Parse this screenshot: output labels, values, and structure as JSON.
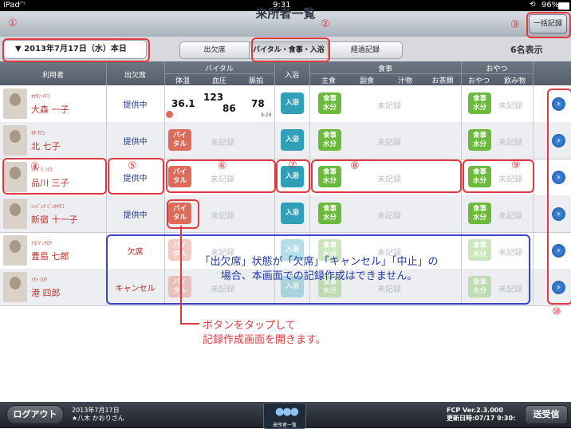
{
  "status_bar": {
    "carrier": "iPad",
    "time": "9:31",
    "battery": "96%"
  },
  "nav": {
    "title": "来所者一覧",
    "bulk_button": "一括記録"
  },
  "toolbar": {
    "date": "▼ 2013年7月17日（水）本日",
    "tabs": [
      "出欠席",
      "バイタル・食事・入浴",
      "経過記録"
    ],
    "count": "6名表示"
  },
  "header": {
    "user": "利用者",
    "attendance": "出欠席",
    "vital": "バイタル",
    "vital_sub": [
      "体温",
      "血圧",
      "脈拍"
    ],
    "bath": "入浴",
    "meal": "食事",
    "meal_sub": [
      "主食",
      "副食",
      "汁物",
      "お茶類"
    ],
    "snack": "おやつ",
    "snack_sub": [
      "おやつ",
      "飲み物"
    ]
  },
  "labels": {
    "vital_pill": "バイ\nタル",
    "bath_pill": "入浴",
    "meal_pill": "食事\n水分",
    "unrecorded": "未記録",
    "vital_time": "9:28"
  },
  "rows": [
    {
      "kana": "ｵｵﾓﾘ  ｲﾁｺ",
      "name": "大森 一子",
      "attendance": "提供中",
      "vitals": {
        "temp": "36.1",
        "bp_high": "123",
        "bp_low": "86",
        "pulse": "78"
      }
    },
    {
      "kana": "ｷﾀ  ﾅﾅｺ",
      "name": "北 七子",
      "attendance": "提供中"
    },
    {
      "kana": "ｼﾅｶﾞﾜ  ﾐﾂｺ",
      "name": "品川 三子",
      "attendance": "提供中"
    },
    {
      "kana": "ｼﾝｼﾞｭｸ  ｼﾞｭｳｲﾁｺ",
      "name": "新宿 十一子",
      "attendance": "提供中"
    },
    {
      "kana": "ﾄﾖｼﾏ  ｼﾁﾛｳ",
      "name": "豊島 七郎",
      "attendance": "欠席"
    },
    {
      "kana": "ﾐﾅﾄ  ｼﾛｳ",
      "name": "港 四郎",
      "attendance": "キャンセル"
    }
  ],
  "annotations": {
    "markers": [
      "①",
      "②",
      "③",
      "④",
      "⑤",
      "⑥",
      "⑦",
      "⑧",
      "⑨",
      "⑩"
    ],
    "blue_note_1": "「出欠席」状態が「欠席」「キャンセル」「中止」の",
    "blue_note_2": "場合、本画面での記録作成はできません。",
    "red_note_1": "ボタンをタップして",
    "red_note_2": "記録作成画面を開きます。"
  },
  "footer": {
    "logout": "ログアウト",
    "date": "2013年7月17日",
    "user": "★八木 かおりさん",
    "center_label": "来所者一覧",
    "version": "FCP Ver.2.3.000",
    "updated": "更新日時:07/17 9:30:",
    "sync": "送受信"
  },
  "colors": {
    "accent_red": "#e03a40",
    "note_blue": "#3a44c8",
    "name_red": "#c0332e"
  }
}
